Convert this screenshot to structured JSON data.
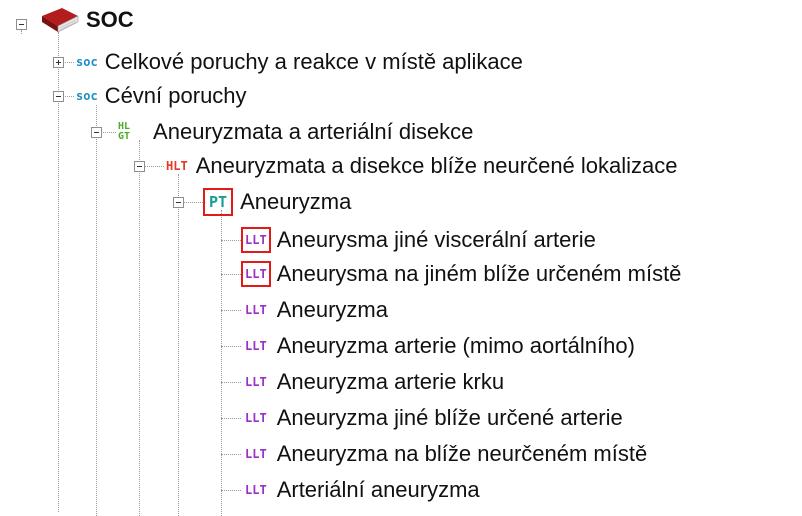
{
  "tree": {
    "root": {
      "label": "SOC",
      "icon": "book-icon"
    },
    "badges": {
      "soc": "soc",
      "hlgt_top": "HL",
      "hlgt_bottom": "GT",
      "hlt": "HLT",
      "pt": "PT",
      "llt": "LLT"
    },
    "soc_items": [
      {
        "label": "Celkové poruchy a reakce v místě aplikace",
        "expanded": false
      },
      {
        "label": "Cévní poruchy",
        "expanded": true
      }
    ],
    "hlgt": {
      "label": "Aneuryzmata a arteriální disekce"
    },
    "hlt": {
      "label": "Aneuryzmata a disekce blíže neurčené lokalizace"
    },
    "pt": {
      "label": "Aneuryzma",
      "highlighted": true
    },
    "llt_items": [
      {
        "label": "Aneurysma jiné viscerální arterie",
        "highlighted": true
      },
      {
        "label": "Aneurysma na jiném blíže určeném místě",
        "highlighted": true
      },
      {
        "label": "Aneuryzma",
        "highlighted": false
      },
      {
        "label": "Aneuryzma arterie (mimo aortálního)",
        "highlighted": false
      },
      {
        "label": "Aneuryzma arterie krku",
        "highlighted": false
      },
      {
        "label": "Aneuryzma jiné blíže určené arterie",
        "highlighted": false
      },
      {
        "label": "Aneuryzma na blíže neurčeném místě",
        "highlighted": false
      },
      {
        "label": "Arteriální aneuryzma",
        "highlighted": false
      }
    ]
  },
  "colors": {
    "soc": "#1e8fc6",
    "hlgt": "#4cad2c",
    "hlt": "#e43a22",
    "pt": "#1a9b95",
    "llt": "#9b2fc9",
    "highlight_border": "#e21a1a"
  }
}
